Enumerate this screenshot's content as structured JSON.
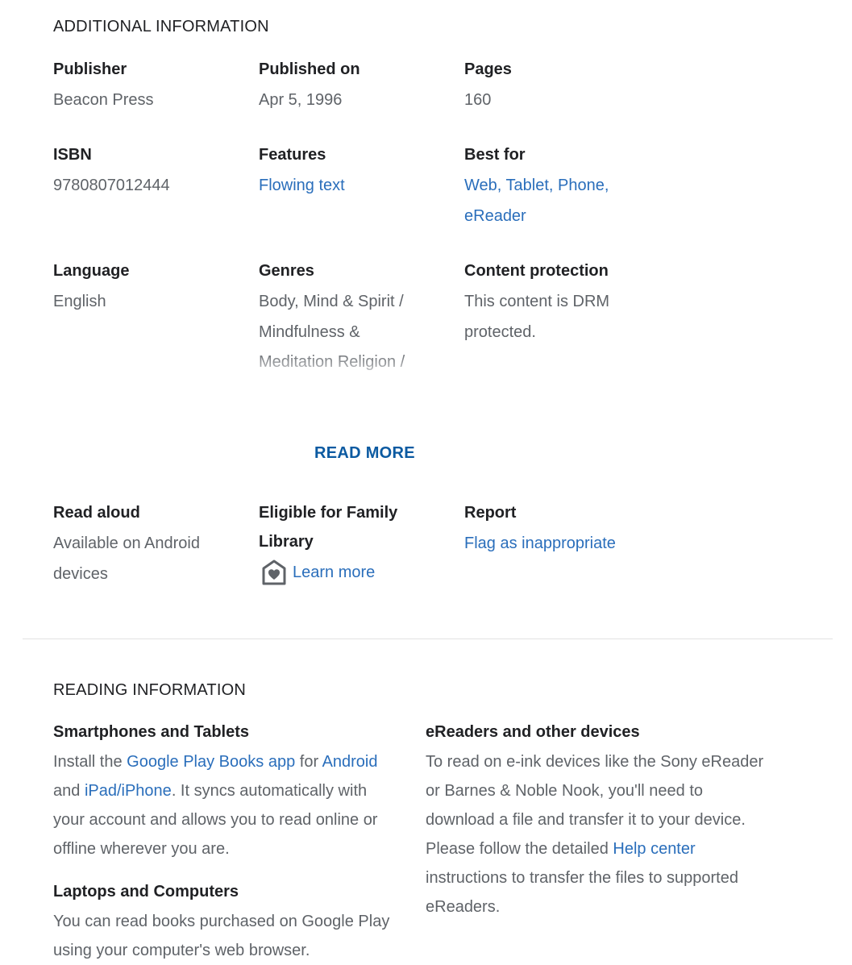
{
  "additional": {
    "title": "ADDITIONAL INFORMATION",
    "publisher": {
      "label": "Publisher",
      "value": "Beacon Press"
    },
    "published": {
      "label": "Published on",
      "value": "Apr 5, 1996"
    },
    "pages": {
      "label": "Pages",
      "value": "160"
    },
    "isbn": {
      "label": "ISBN",
      "value": "9780807012444"
    },
    "features": {
      "label": "Features",
      "value": "Flowing text"
    },
    "best_for": {
      "label": "Best for",
      "value": "Web, Tablet, Phone, eReader"
    },
    "language": {
      "label": "Language",
      "value": "English"
    },
    "genres": {
      "label": "Genres",
      "line1": "Body, Mind & Spirit / Mindfulness & Meditation",
      "line2": "Religion / Buddhism /"
    },
    "content_protection": {
      "label": "Content protection",
      "value": "This content is DRM protected."
    },
    "read_more": "READ MORE",
    "read_aloud": {
      "label": "Read aloud",
      "value": "Available on Android devices"
    },
    "family_library": {
      "label": "Eligible for Family Library",
      "link": "Learn more"
    },
    "report": {
      "label": "Report",
      "link": "Flag as inappropriate"
    }
  },
  "reading": {
    "title": "READING INFORMATION",
    "smartphones": {
      "label": "Smartphones and Tablets",
      "t1": "Install the ",
      "l1": "Google Play Books app",
      "t2": " for ",
      "l2": "Android",
      "t3": " and ",
      "l3": "iPad/iPhone",
      "t4": ". It syncs automatically with your account and allows you to read online or offline wherever you are."
    },
    "laptops": {
      "label": "Laptops and Computers",
      "text": "You can read books purchased on Google Play using your computer's web browser."
    },
    "ereaders": {
      "label": "eReaders and other devices",
      "t1": "To read on e-ink devices like the Sony eReader or Barnes & Noble Nook, you'll need to download a file and transfer it to your device. Please follow the detailed ",
      "l1": "Help center",
      "t2": " instructions to transfer the files to supported eReaders."
    }
  },
  "colors": {
    "link": "#2a6ebb",
    "read_more": "#0b5aa1",
    "text": "#202124",
    "muted": "#5f6368"
  },
  "icons": {
    "family_library": "family-library-house-heart-icon"
  }
}
